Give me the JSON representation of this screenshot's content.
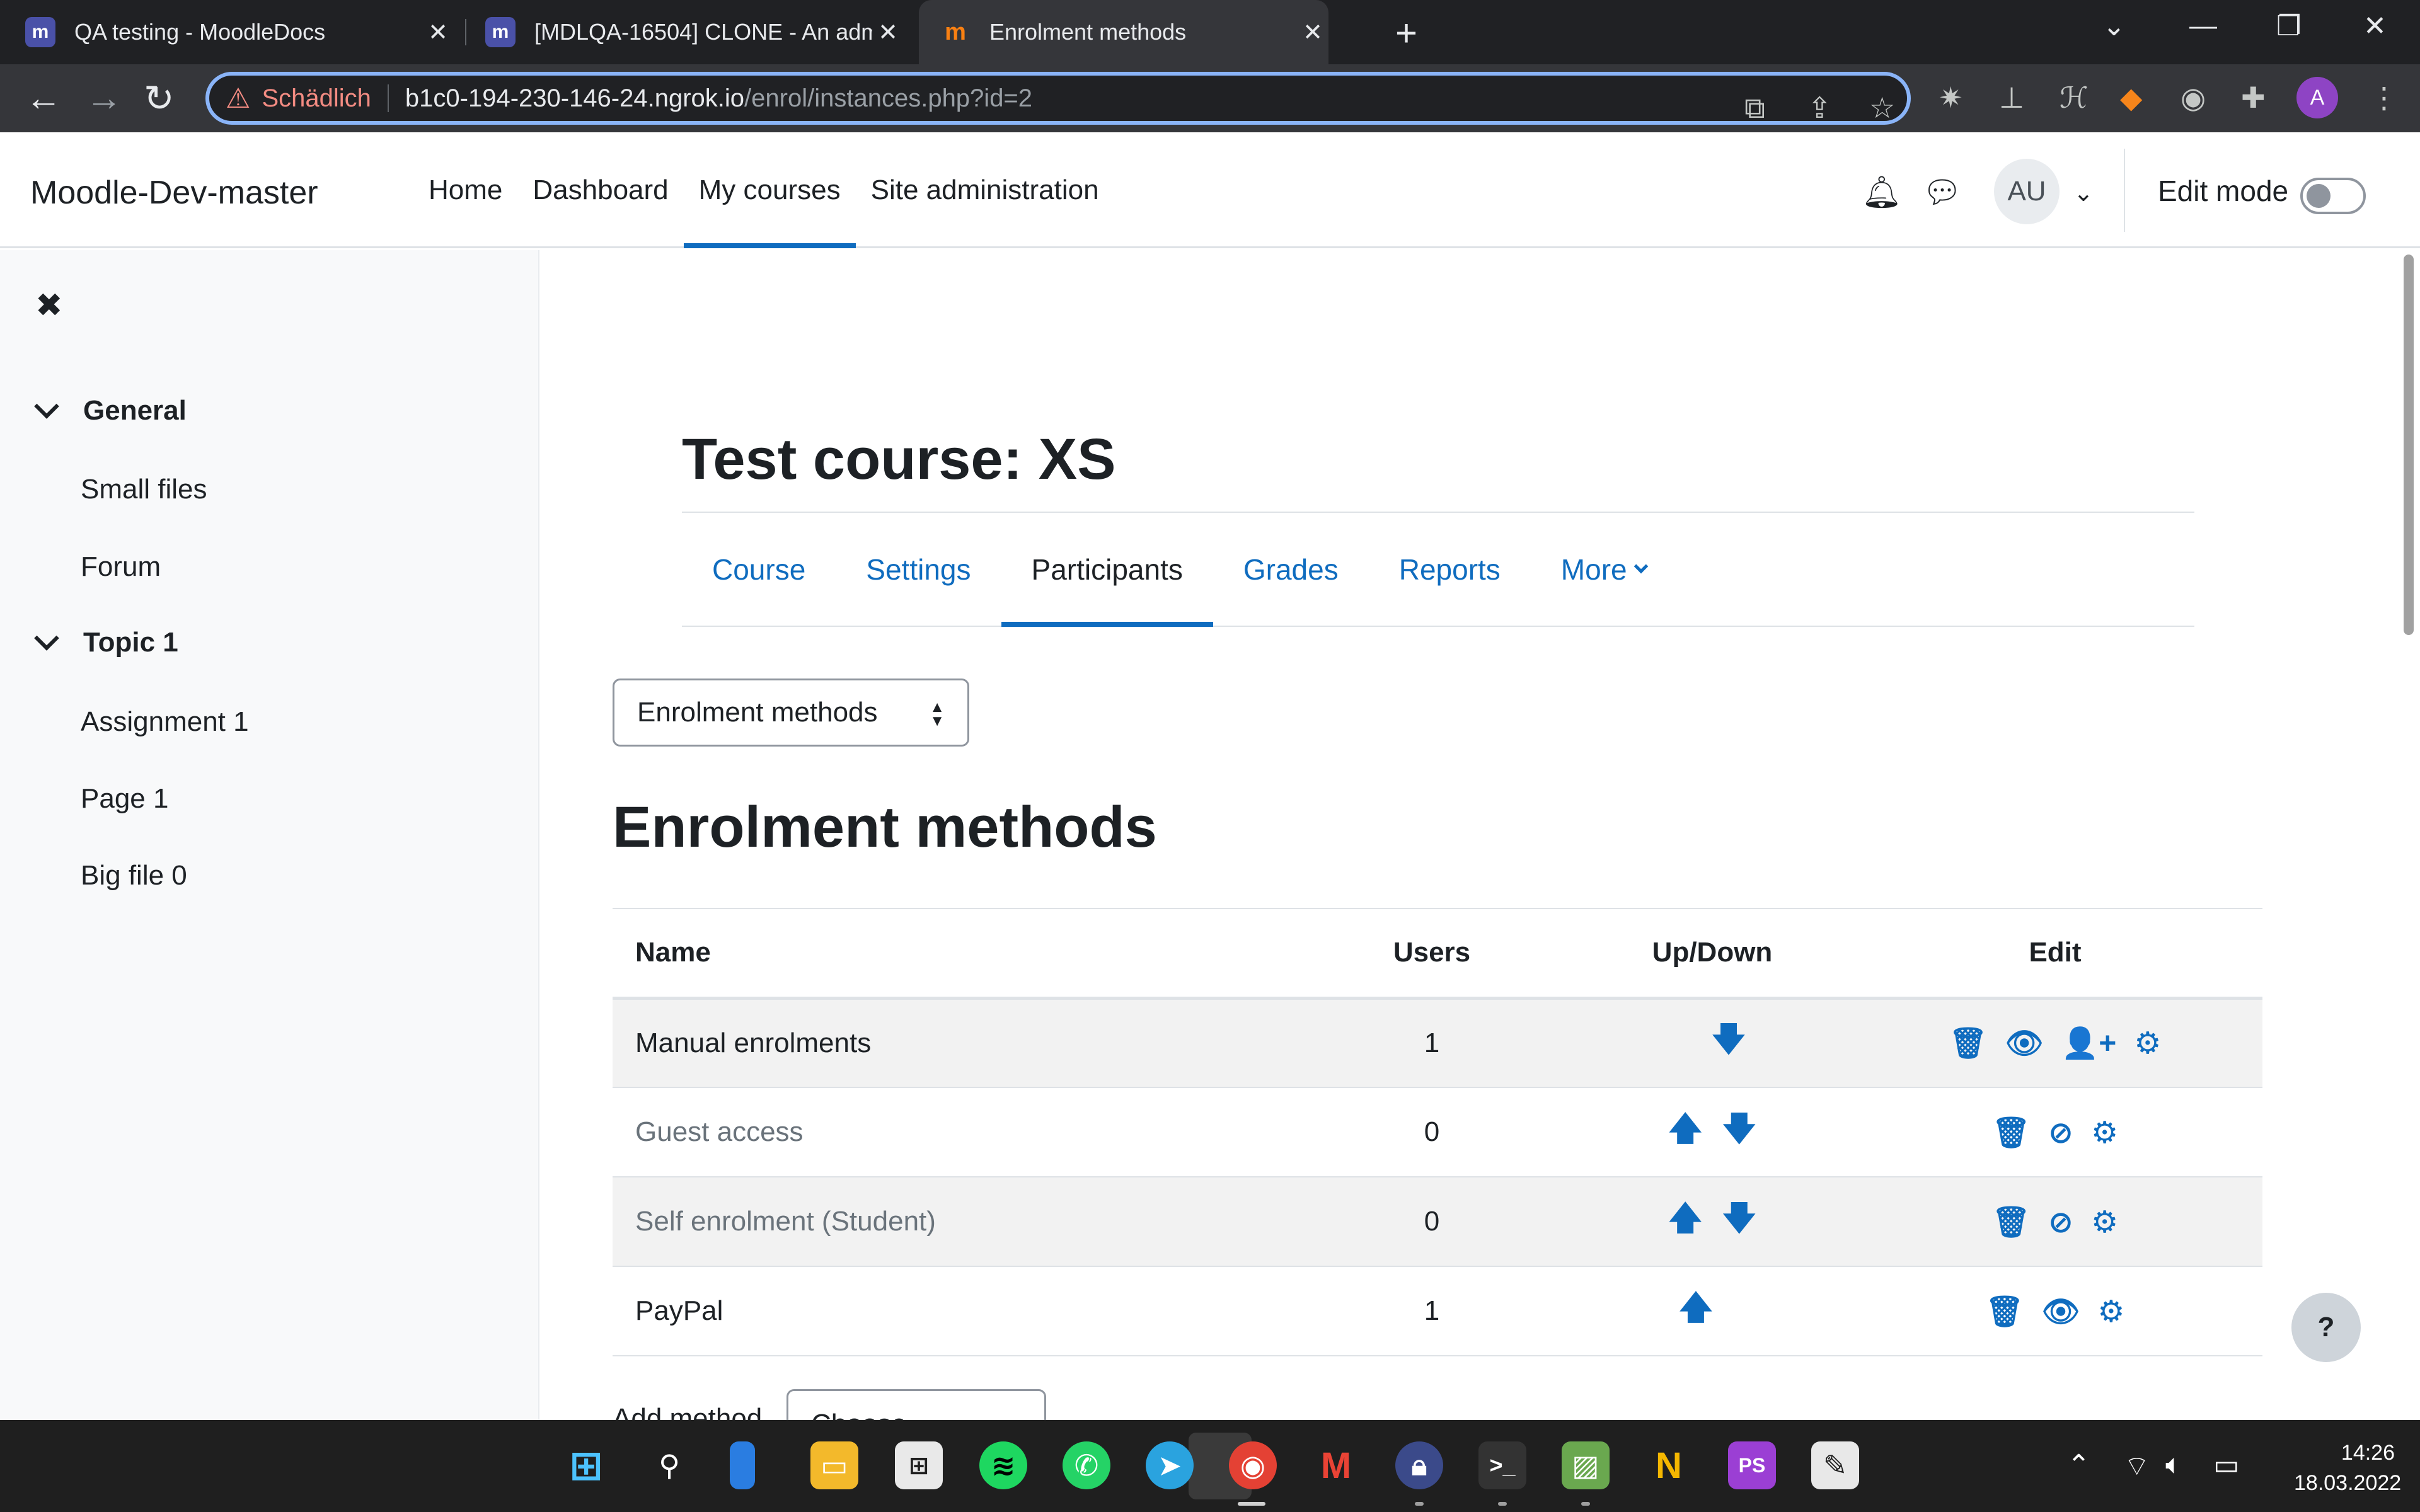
{
  "browser": {
    "tabs": [
      {
        "title": "QA testing - MoodleDocs",
        "favicon": "moodle-icon"
      },
      {
        "title": "[MDLQA-16504] CLONE - An adm",
        "favicon": "moodle-icon"
      },
      {
        "title": "Enrolment methods",
        "favicon": "moodle-orange-icon"
      }
    ],
    "omnibox": {
      "warning_label": "Schädlich",
      "host": "b1c0-194-230-146-24.ngrok.io",
      "path": "/enrol/instances.php?id=2"
    },
    "profile_initial": "A"
  },
  "navbar": {
    "brand": "Moodle-Dev-master",
    "items": [
      "Home",
      "Dashboard",
      "My courses",
      "Site administration"
    ],
    "active_item": "My courses",
    "avatar_initials": "AU",
    "edit_mode_label": "Edit mode",
    "edit_mode_on": false
  },
  "drawer": {
    "sections": [
      {
        "title": "General",
        "items": [
          "Small files",
          "Forum"
        ]
      },
      {
        "title": "Topic 1",
        "items": [
          "Assignment 1",
          "Page 1",
          "Big file 0"
        ]
      }
    ]
  },
  "course": {
    "title": "Test course: XS",
    "tabs": [
      "Course",
      "Settings",
      "Participants",
      "Grades",
      "Reports",
      "More"
    ],
    "active_tab": "Participants"
  },
  "page": {
    "select_value": "Enrolment methods",
    "heading": "Enrolment methods",
    "add_method_label": "Add method",
    "add_method_value": "Choose..."
  },
  "table": {
    "headers": [
      "Name",
      "Users",
      "Up/Down",
      "Edit"
    ],
    "rows": [
      {
        "name": "Manual enrolments",
        "users": "1",
        "up": false,
        "down": true,
        "enabled": true,
        "edit_icons": [
          "trash-icon",
          "eye-icon",
          "enrol-users-icon",
          "cog-icon"
        ]
      },
      {
        "name": "Guest access",
        "users": "0",
        "up": true,
        "down": true,
        "enabled": false,
        "edit_icons": [
          "trash-icon",
          "eye-slash-icon",
          "cog-icon"
        ]
      },
      {
        "name": "Self enrolment (Student)",
        "users": "0",
        "up": true,
        "down": true,
        "enabled": false,
        "edit_icons": [
          "trash-icon",
          "eye-slash-icon",
          "cog-icon"
        ]
      },
      {
        "name": "PayPal",
        "users": "1",
        "up": true,
        "down": false,
        "enabled": true,
        "edit_icons": [
          "trash-icon",
          "eye-icon",
          "cog-icon"
        ]
      }
    ]
  },
  "help_label": "?",
  "taskbar": {
    "time": "14:26",
    "date": "18.03.2022"
  },
  "colors": {
    "link": "#0f6cbf",
    "browser_dark": "#202124",
    "toolbar": "#35363a",
    "warning": "#f28b82",
    "taskbar": "#1f1f1f"
  }
}
